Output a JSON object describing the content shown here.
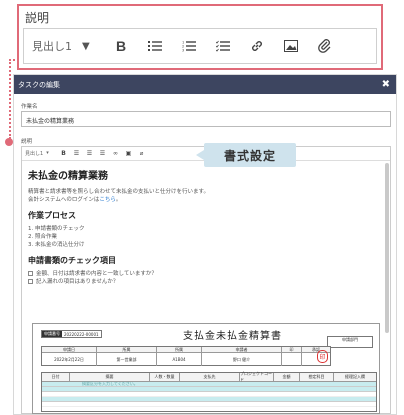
{
  "callout": {
    "title": "説明",
    "toolbar": {
      "heading_select": "見出し1",
      "bold": "B"
    }
  },
  "dialog": {
    "title": "タスクの編集",
    "close": "✖",
    "name_label": "作業名",
    "name_value": "未払金の精算業務",
    "desc_label": "説明",
    "mini_toolbar": {
      "heading_select": "見出し1",
      "bold": "B"
    }
  },
  "tooltip": "書式設定",
  "content": {
    "heading": "未払金の精算業務",
    "intro_line1": "精算書と請求書等を照らし合わせて未払金の支払いと仕分けを行います。",
    "intro_line2_prefix": "会計システムへのログインは",
    "intro_link": "こちら",
    "intro_line2_suffix": "。",
    "process_heading": "作業プロセス",
    "steps": [
      "1. 申請書類のチェック",
      "2. 照合作業",
      "3. 未払金の消込仕分け"
    ],
    "check_heading": "申請書類のチェック項目",
    "checks": [
      "金額、日付は請求書の内容と一致していますか？",
      "記入漏れの項目はありませんか？"
    ]
  },
  "document": {
    "pill_key": "申請番号",
    "pill_value": "20220222-00001",
    "title": "支払金未払金精算書",
    "dept_label": "申請部門",
    "table1_headers": [
      "申請日",
      "所属",
      "所属",
      "申請者",
      "印",
      "承認"
    ],
    "table1_values": [
      "2022年2月22日",
      "第一営業部",
      "A1B04",
      "野口 健介",
      "",
      ""
    ],
    "stamp": "印",
    "table2_headers": [
      "日付",
      "摘要",
      "人数・数量",
      "支払先",
      "プロジェクトコード",
      "金額",
      "勘定科目",
      "経理記入欄"
    ],
    "table2_hint": "摘要区分を入力してください。"
  }
}
